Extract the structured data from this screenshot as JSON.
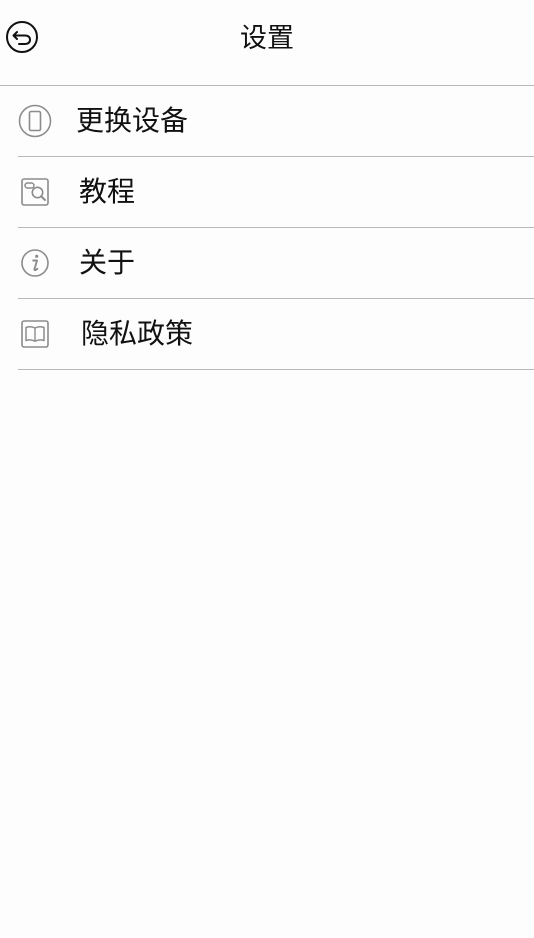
{
  "header": {
    "title": "设置",
    "back_icon": "back-arrow-circle-icon"
  },
  "menu": {
    "items": [
      {
        "label": "更换设备",
        "icon": "phone-device-icon"
      },
      {
        "label": "教程",
        "icon": "tutorial-search-icon"
      },
      {
        "label": "关于",
        "icon": "info-icon"
      },
      {
        "label": "隐私政策",
        "icon": "book-icon"
      }
    ]
  },
  "colors": {
    "background": "#fdfdfd",
    "divider": "#b8b8b8",
    "icon_gray": "#8c8c8c",
    "text": "#111111"
  }
}
